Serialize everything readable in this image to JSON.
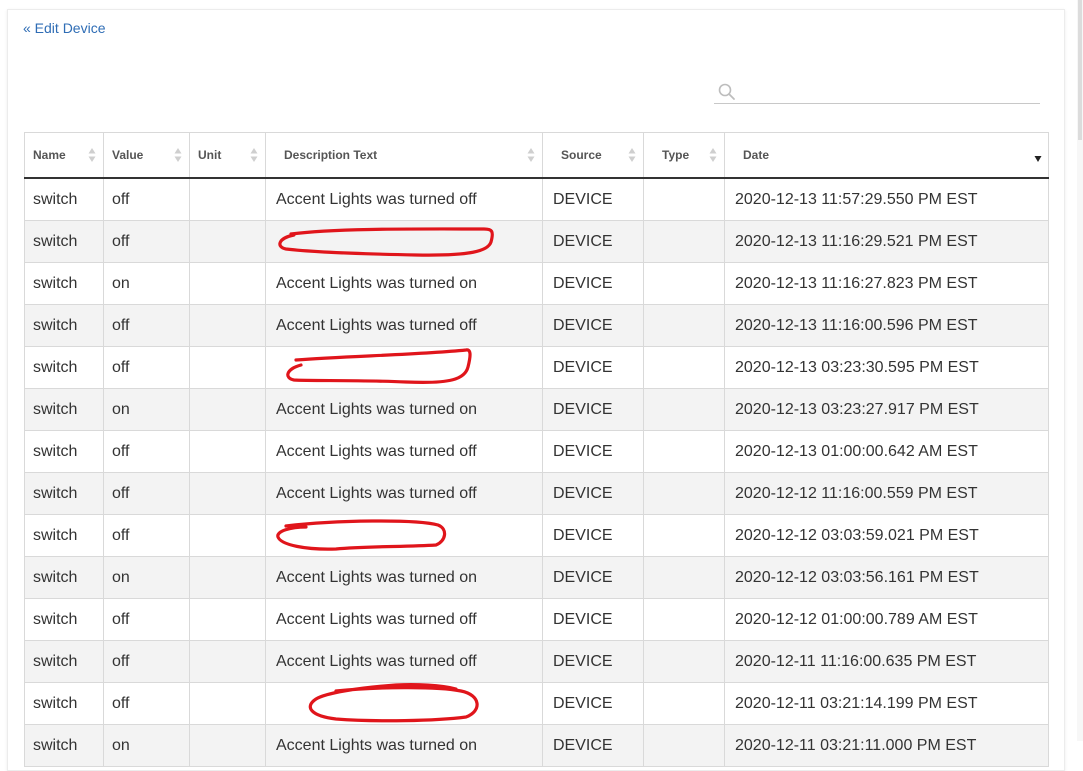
{
  "nav": {
    "back_label": "« Edit Device"
  },
  "search": {
    "value": "",
    "placeholder": ""
  },
  "table": {
    "columns": [
      "Name",
      "Value",
      "Unit",
      "Description Text",
      "Source",
      "Type",
      "Date"
    ],
    "rows": [
      {
        "name": "switch",
        "value": "off",
        "unit": "",
        "description": "Accent Lights was turned off",
        "source": "DEVICE",
        "type": "",
        "date": "2020-12-13 11:57:29.550 PM EST",
        "redacted": false
      },
      {
        "name": "switch",
        "value": "off",
        "unit": "",
        "description": "",
        "source": "DEVICE",
        "type": "",
        "date": "2020-12-13 11:16:29.521 PM EST",
        "redacted": true
      },
      {
        "name": "switch",
        "value": "on",
        "unit": "",
        "description": "Accent Lights was turned on",
        "source": "DEVICE",
        "type": "",
        "date": "2020-12-13 11:16:27.823 PM EST",
        "redacted": false
      },
      {
        "name": "switch",
        "value": "off",
        "unit": "",
        "description": "Accent Lights was turned off",
        "source": "DEVICE",
        "type": "",
        "date": "2020-12-13 11:16:00.596 PM EST",
        "redacted": false
      },
      {
        "name": "switch",
        "value": "off",
        "unit": "",
        "description": "",
        "source": "DEVICE",
        "type": "",
        "date": "2020-12-13 03:23:30.595 PM EST",
        "redacted": true
      },
      {
        "name": "switch",
        "value": "on",
        "unit": "",
        "description": "Accent Lights was turned on",
        "source": "DEVICE",
        "type": "",
        "date": "2020-12-13 03:23:27.917 PM EST",
        "redacted": false
      },
      {
        "name": "switch",
        "value": "off",
        "unit": "",
        "description": "Accent Lights was turned off",
        "source": "DEVICE",
        "type": "",
        "date": "2020-12-13 01:00:00.642 AM EST",
        "redacted": false
      },
      {
        "name": "switch",
        "value": "off",
        "unit": "",
        "description": "Accent Lights was turned off",
        "source": "DEVICE",
        "type": "",
        "date": "2020-12-12 11:16:00.559 PM EST",
        "redacted": false
      },
      {
        "name": "switch",
        "value": "off",
        "unit": "",
        "description": "",
        "source": "DEVICE",
        "type": "",
        "date": "2020-12-12 03:03:59.021 PM EST",
        "redacted": true
      },
      {
        "name": "switch",
        "value": "on",
        "unit": "",
        "description": "Accent Lights was turned on",
        "source": "DEVICE",
        "type": "",
        "date": "2020-12-12 03:03:56.161 PM EST",
        "redacted": false
      },
      {
        "name": "switch",
        "value": "off",
        "unit": "",
        "description": "Accent Lights was turned off",
        "source": "DEVICE",
        "type": "",
        "date": "2020-12-12 01:00:00.789 AM EST",
        "redacted": false
      },
      {
        "name": "switch",
        "value": "off",
        "unit": "",
        "description": "Accent Lights was turned off",
        "source": "DEVICE",
        "type": "",
        "date": "2020-12-11 11:16:00.635 PM EST",
        "redacted": false
      },
      {
        "name": "switch",
        "value": "off",
        "unit": "",
        "description": "",
        "source": "DEVICE",
        "type": "",
        "date": "2020-12-11 03:21:14.199 PM EST",
        "redacted": true
      },
      {
        "name": "switch",
        "value": "on",
        "unit": "",
        "description": "Accent Lights was turned on",
        "source": "DEVICE",
        "type": "",
        "date": "2020-12-11 03:21:11.000 PM EST",
        "redacted": false
      }
    ]
  },
  "colors": {
    "link": "#2f6db5",
    "text": "#333333",
    "row_alt": "#f3f3f3",
    "border": "#d9d9d9",
    "redaction": "#e0151b"
  },
  "icons": {
    "search": "search-icon",
    "sort": "sort-both-icon",
    "sort_active": "sort-desc-icon"
  }
}
